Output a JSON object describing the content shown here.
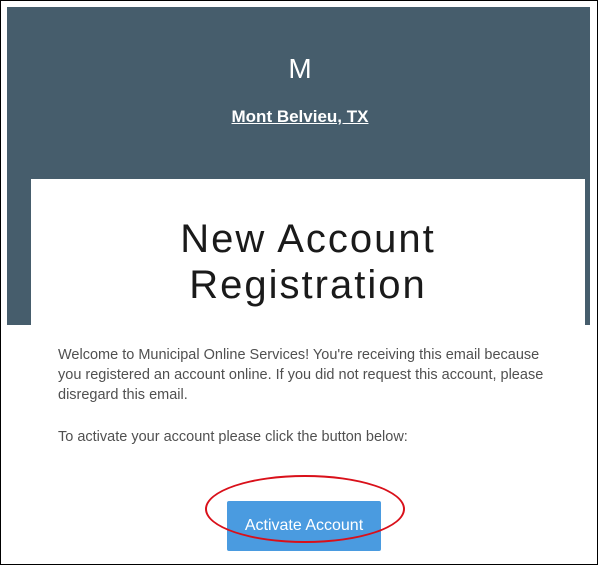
{
  "header": {
    "logo_letter": "M",
    "org_name": "Mont Belvieu, TX"
  },
  "card": {
    "title_line1": "New Account",
    "title_line2": "Registration",
    "welcome_paragraph": "Welcome to Municipal Online Services! You're receiving this email because you registered an account online. If you did not request this account, please disregard this email.",
    "instruction_paragraph": "To activate your account please click the button below:",
    "activate_label": "Activate Account"
  },
  "colors": {
    "header_background": "#465d6c",
    "button_background": "#4a9be0",
    "annotation_ring": "#d9101a"
  }
}
